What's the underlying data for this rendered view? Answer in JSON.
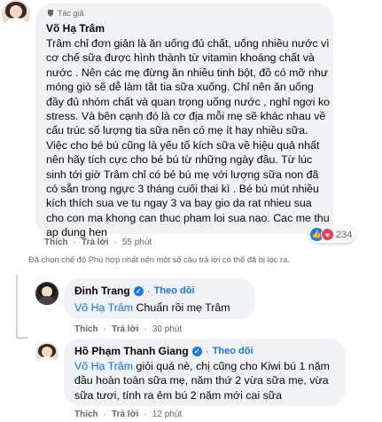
{
  "main_comment": {
    "author_badge": "Tác giả",
    "author_name": "Võ Hạ Trâm",
    "text": "Trâm chỉ đơn giản là ăn uống đủ chất, uống nhiều nước vì cơ chế sữa được hình thành từ vitamin khoáng chất và nước . Nên các mẹ đừng ăn nhiều tinh bột, đồ có mỡ như móng giò sẽ dễ làm tắt tia sữa xuống. Chỉ nên ăn uống đầy đủ nhóm chất và quan trọng uống nước , nghỉ ngơi ko stress. Và bên cạnh đó là cơ địa mỗi mẹ sẽ khác nhau về cấu trúc số lượng tia sữa nên có mẹ ít hay nhiều sữa. Việc cho bé bú cũng là yếu tố kích sữa về hiệu quả nhất nên hãy tích cực cho bé bú từ những ngày đầu. Từ lúc sinh tới giờ Trâm chỉ có bé bú mẹ với lượng sữa non đã có sẵn trong ngực 3 tháng cuối thai kì . Bé bú mút nhiều kích thích sua ve tu ngay 3 va bay gio da rat nhieu sua cho con ma khong can thuc pham loi sua nao. Cac me thu ap dung hen",
    "reaction_count": "234",
    "like_label": "Thích",
    "reply_label": "Trả lời",
    "time": "55 phút"
  },
  "filter_note": "Đã chọn chế độ Phù hợp nhất nên một số câu trả lời có thể đã bị lọc ra.",
  "replies": [
    {
      "author_name": "Đinh Trang",
      "follow_label": "Theo dõi",
      "mention": "Võ Hạ Trâm",
      "text": " Chuẩn rồi mẹ Trâm",
      "like_label": "Thích",
      "reply_label": "Trả lời",
      "time": "30 phút"
    },
    {
      "author_name": "Hồ Phạm Thanh Giang",
      "follow_label": "Theo dõi",
      "mention": "Võ Hạ Trâm",
      "text": " giỏi quá nè, chị cũng cho Kiwi bú 1 năm đầu hoàn toàn sữa mẹ, năm thứ 2 vừa sữa mẹ, vừa sữa tươi, tính ra ẻm bú 2 năm mới cai sữa",
      "like_label": "Thích",
      "reply_label": "Trả lời",
      "time": "12 phút"
    }
  ],
  "colors": {
    "bubble": "#f0f2f5",
    "link_blue": "#1877f2",
    "muted": "#65676b"
  }
}
